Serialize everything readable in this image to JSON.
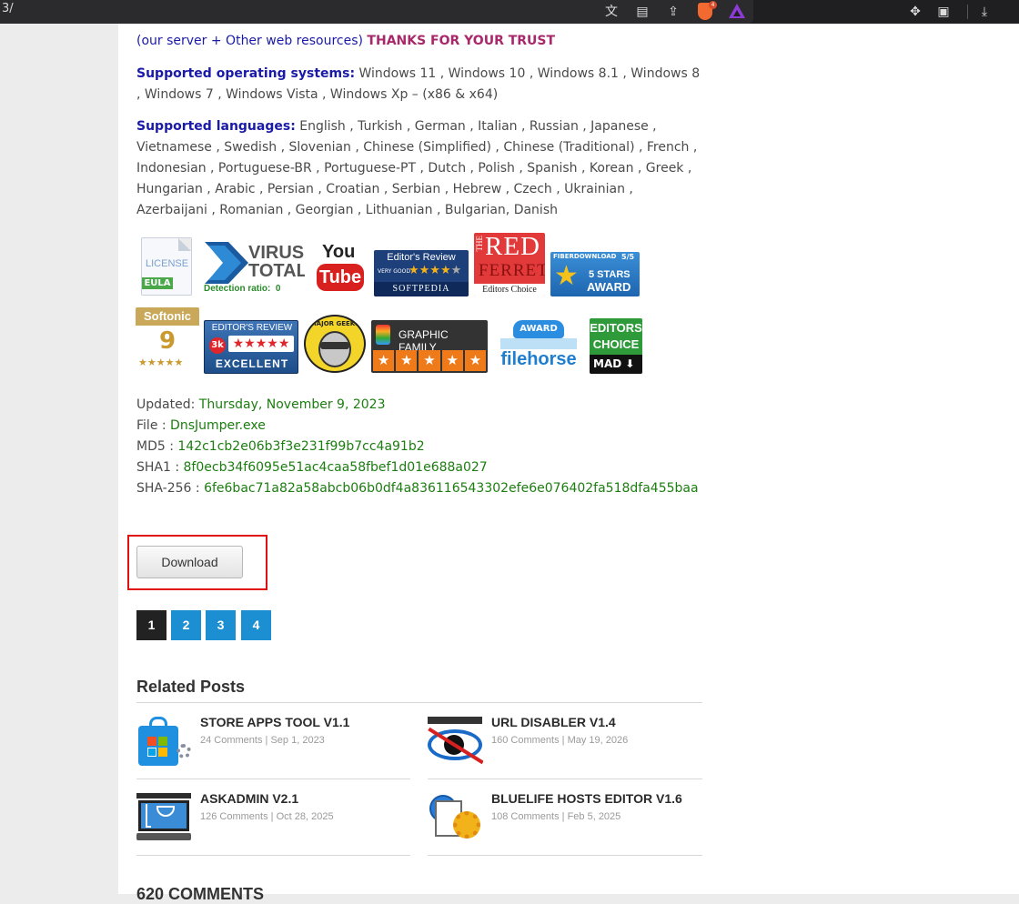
{
  "browser": {
    "url_fragment": "3/",
    "toolbar_icons": [
      "translate-icon",
      "reader-icon",
      "share-icon",
      "brave-shields-icon",
      "brave-rewards-icon",
      "extensions-icon",
      "wallet-icon",
      "downloads-icon"
    ],
    "shields_count": "4"
  },
  "article": {
    "top_line_prefix": "(our server + Other web resources)",
    "top_line_thanks": "THANKS FOR YOUR TRUST",
    "os_label": "Supported operating systems:",
    "os_value": " Windows 11 , Windows 10 , Windows 8.1 , Windows 8 , Windows 7 , Windows Vista , Windows Xp – (x86 & x64)",
    "lang_label": "Supported languages:",
    "lang_value": " English , Turkish , German , Italian , Russian , Japanese , Vietnamese , Swedish , Slovenian , Chinese (Simplified) , Chinese (Traditional) , French , Indonesian , Portuguese-BR , Portuguese-PT , Dutch , Polish , Spanish , Korean , Greek , Hungarian , Arabic , Persian , Croatian , Serbian , Hebrew , Czech , Ukrainian , Azerbaijani , Romanian , Georgian , Lithuanian , Bulgarian, Danish"
  },
  "badges": {
    "license": {
      "line1": "LICENSE",
      "line2": "EULA"
    },
    "virustotal": {
      "line1": "VIRUS",
      "line2": "TOTAL",
      "detection": "Detection ratio:  0"
    },
    "youtube": {
      "line1": "You",
      "line2": "Tube"
    },
    "softpedia": {
      "line1": "Editor's Review",
      "line2": "VERY GOOD",
      "line3": "SOFTPEDIA"
    },
    "redferret": {
      "line1": "THE",
      "line2": "RED",
      "line3": "FERRET",
      "line4": "Editors Choice"
    },
    "fiberdownload": {
      "line1": "FIBERDOWNLOAD",
      "score": "5/5",
      "line2": "5 STARS",
      "line3": "AWARD"
    },
    "softonic": {
      "line1": "Softonic",
      "score": "9"
    },
    "threek": {
      "line1": "EDITOR'S REVIEW",
      "logo": "3k",
      "line2": "EXCELLENT"
    },
    "majorgeeks": {
      "line1": "MAJOR GEEKS"
    },
    "graphicfamily": {
      "line1": "GRAPHIC FAMILY"
    },
    "filehorse": {
      "line1": "AWARD",
      "line2": "filehorse"
    },
    "editorschoice": {
      "line1": "EDITORS",
      "line2": "CHOICE",
      "line3": "MAD"
    }
  },
  "fileinfo": {
    "updated_label": "Updated: ",
    "updated_value": "Thursday, November 9, 2023",
    "file_label": "File : ",
    "file_value": "DnsJumper.exe",
    "md5_label": "MD5 : ",
    "md5_value": "142c1cb2e06b3f3e231f99b7cc4a91b2",
    "sha1_label": "SHA1 : ",
    "sha1_value": "8f0ecb34f6095e51ac4caa58fbef1d01e688a027",
    "sha256_label": "SHA-256 : ",
    "sha256_value": "6fe6bac71a82a58abcb06b0df4a836116543302efe6e076402fa518dfa455baa"
  },
  "download": {
    "label": "Download"
  },
  "pagination": {
    "pages": [
      "1",
      "2",
      "3",
      "4"
    ],
    "current_color": "#222222",
    "other_color": "#1b8fd1"
  },
  "related": {
    "heading": "Related Posts",
    "posts": [
      {
        "title": "STORE APPS TOOL V1.1",
        "comments": "24 Comments",
        "date": "Sep 1, 2023",
        "thumb": "store-apps-thumbnail"
      },
      {
        "title": "URL DISABLER V1.4",
        "comments": "160 Comments",
        "date": "May 19, 2026",
        "thumb": "url-disabler-thumbnail"
      },
      {
        "title": "ASKADMIN V2.1",
        "comments": "126 Comments",
        "date": "Oct 28, 2025",
        "thumb": "askadmin-thumbnail"
      },
      {
        "title": "BLUELIFE HOSTS EDITOR V1.6",
        "comments": "108 Comments",
        "date": "Feb 5, 2025",
        "thumb": "hosts-editor-thumbnail"
      }
    ]
  },
  "comments": {
    "heading": "620 COMMENTS"
  }
}
